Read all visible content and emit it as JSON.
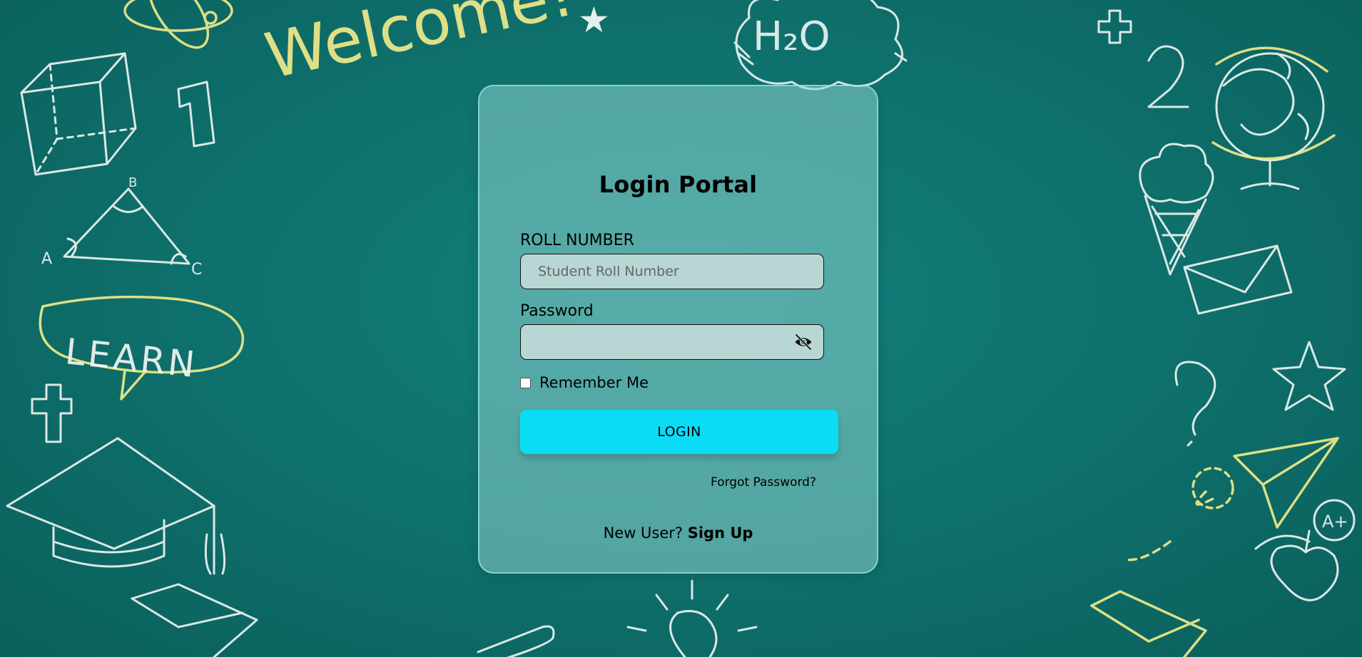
{
  "background": {
    "welcome_text": "Welcome!",
    "learn_text": "LEARN",
    "h2o_text": "H₂O",
    "number_one": "1",
    "number_two": "2",
    "triangle_a": "A",
    "triangle_b": "B",
    "triangle_c": "C",
    "grade_badge": "A+",
    "question_mark": "?"
  },
  "card": {
    "title": "Login Portal",
    "roll_label": "ROLL NUMBER",
    "roll_placeholder": "Student Roll Number",
    "roll_value": "",
    "password_label": "Password",
    "password_value": "",
    "eye_icon": "eye-off-icon",
    "remember_label": "Remember Me",
    "remember_checked": false,
    "login_label": "LOGIN",
    "forgot_label": "Forgot Password?",
    "new_user_text": "New User?",
    "signup_label": "Sign Up"
  },
  "colors": {
    "background": "#0f726e",
    "card": "#8cd2ce",
    "button": "#0adcf6",
    "input": "#b8d6d4",
    "chalk_yellow": "#f0ea8a",
    "chalk_white": "#f2f6f4"
  }
}
